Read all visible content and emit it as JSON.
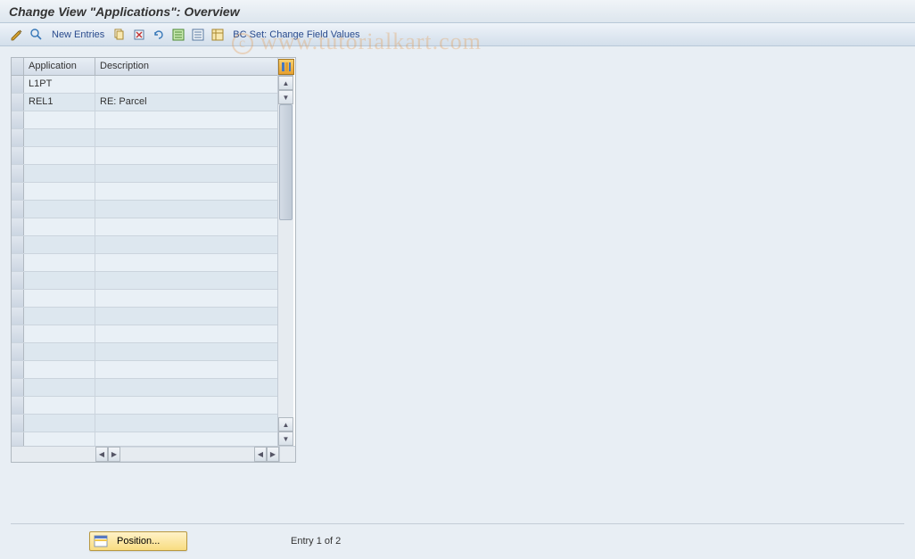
{
  "title": "Change View \"Applications\": Overview",
  "toolbar": {
    "new_entries": "New Entries",
    "bc_set": "BC Set: Change Field Values"
  },
  "table": {
    "headers": {
      "application": "Application",
      "description": "Description"
    },
    "rows": [
      {
        "app": "L1PT",
        "desc": ""
      },
      {
        "app": "REL1",
        "desc": "RE: Parcel"
      },
      {
        "app": "",
        "desc": ""
      },
      {
        "app": "",
        "desc": ""
      },
      {
        "app": "",
        "desc": ""
      },
      {
        "app": "",
        "desc": ""
      },
      {
        "app": "",
        "desc": ""
      },
      {
        "app": "",
        "desc": ""
      },
      {
        "app": "",
        "desc": ""
      },
      {
        "app": "",
        "desc": ""
      },
      {
        "app": "",
        "desc": ""
      },
      {
        "app": "",
        "desc": ""
      },
      {
        "app": "",
        "desc": ""
      },
      {
        "app": "",
        "desc": ""
      },
      {
        "app": "",
        "desc": ""
      },
      {
        "app": "",
        "desc": ""
      },
      {
        "app": "",
        "desc": ""
      },
      {
        "app": "",
        "desc": ""
      },
      {
        "app": "",
        "desc": ""
      },
      {
        "app": "",
        "desc": ""
      },
      {
        "app": "",
        "desc": ""
      }
    ]
  },
  "footer": {
    "position": "Position...",
    "entry": "Entry 1 of 2"
  },
  "watermark": "www.tutorialkart.com"
}
